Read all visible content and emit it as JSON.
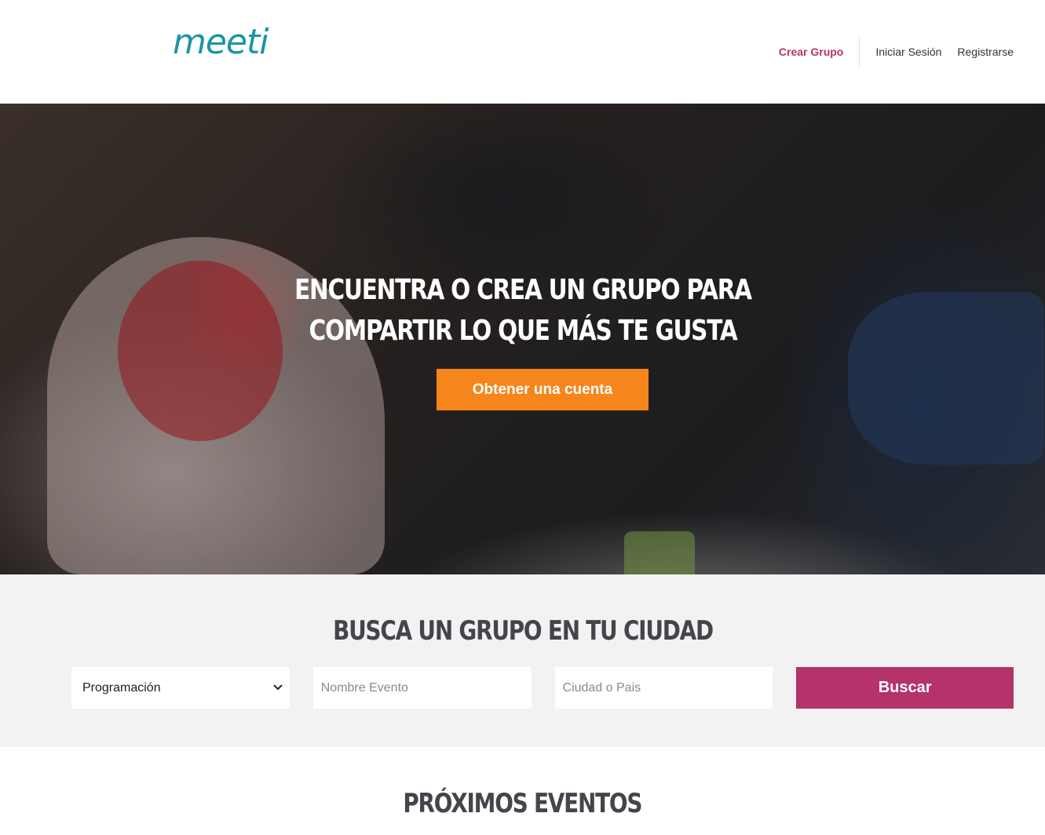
{
  "header": {
    "logo": "meeti",
    "nav": {
      "create_group": "Crear Grupo",
      "login": "Iniciar Sesión",
      "register": "Registrarse"
    }
  },
  "hero": {
    "title": "Encuentra o crea un grupo para compartir lo que más te gusta",
    "cta": "Obtener una cuenta"
  },
  "search": {
    "title": "Busca un grupo en tu ciudad",
    "category_selected": "Programación",
    "event_placeholder": "Nombre Evento",
    "location_placeholder": "Ciudad o Pais",
    "button": "Buscar"
  },
  "events": {
    "title": "Próximos Eventos"
  },
  "colors": {
    "brand_teal": "#1a95a5",
    "accent_pink": "#b5326b",
    "cta_orange": "#f6851b"
  }
}
